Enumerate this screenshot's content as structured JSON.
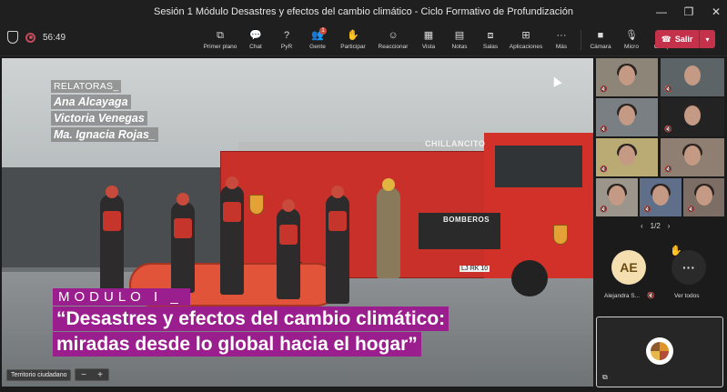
{
  "window": {
    "title": "Sesión 1 Módulo Desastres y efectos del cambio climático - Ciclo Formativo de Profundización",
    "minimize_icon": "—",
    "restore_icon": "❐",
    "close_icon": "✕"
  },
  "meeting": {
    "timer": "56:49"
  },
  "toolbar": {
    "items": [
      {
        "label": "Primer plano",
        "icon": "⧉"
      },
      {
        "label": "Chat",
        "icon": "💬"
      },
      {
        "label": "PyR",
        "icon": "?"
      },
      {
        "label": "Gente",
        "icon": "👥",
        "badge": "1"
      },
      {
        "label": "Participar",
        "icon": "✋"
      },
      {
        "label": "Reaccionar",
        "icon": "☺"
      },
      {
        "label": "Vista",
        "icon": "▦"
      },
      {
        "label": "Notas",
        "icon": "▤"
      },
      {
        "label": "Salas",
        "icon": "⧈"
      },
      {
        "label": "Aplicaciones",
        "icon": "⊞"
      },
      {
        "label": "Más",
        "icon": "···"
      }
    ],
    "media": [
      {
        "label": "Cámara",
        "icon": "■"
      },
      {
        "label": "Micro",
        "icon": "🎙"
      },
      {
        "label": "Compartir",
        "icon": "⇧"
      }
    ],
    "leave_label": "Salir",
    "leave_icon": "☎",
    "leave_dropdown_icon": "▾"
  },
  "slide": {
    "relatoras_heading": "RELATORAS_",
    "relatoras": [
      "Ana Alcayaga",
      "Victoria Venegas",
      "Ma. Ignacia Rojas_"
    ],
    "module_label": "MODULO I _",
    "module_title_line1": "“Desastres y efectos del cambio climático:",
    "module_title_line2": "miradas desde lo global hacia el hogar”",
    "truck_text_top": "CHILLANCITO",
    "truck_text_mid": "BOMBEROS",
    "truck_text_plate": "LJ·RK 10"
  },
  "stage_controls": {
    "source_label": "Territorio ciudadano",
    "zoom_out": "−",
    "zoom_in": "+"
  },
  "participants": {
    "pager": "1/2",
    "prev_icon": "‹",
    "next_icon": "›",
    "mic_off_icon": "🔇",
    "featured": {
      "initials": "AE",
      "name": "Alejandra S...",
      "hand_icon": "✋"
    },
    "more_label": "Ver todos",
    "more_icon": "···",
    "self_ctrl_icon": "⧉"
  }
}
